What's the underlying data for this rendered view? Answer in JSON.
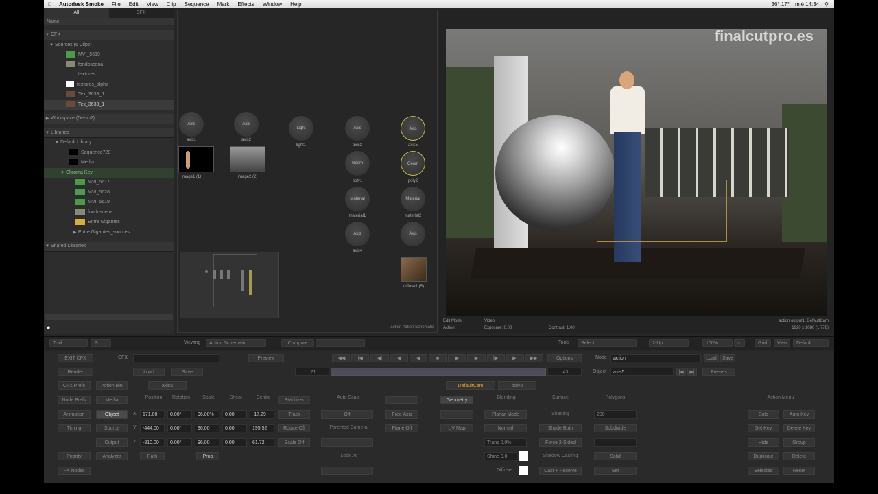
{
  "menubar": {
    "apple": "",
    "app": "Autodesk Smoke",
    "items": [
      "File",
      "Edit",
      "View",
      "Clip",
      "Sequence",
      "Mark",
      "Effects",
      "Window",
      "Help"
    ],
    "status": "36° 17°",
    "clock": "mié 14:34"
  },
  "library": {
    "tabs": [
      "All",
      "CFX"
    ],
    "col_header": "Name",
    "cfx": "CFX",
    "sources": "Sources (6 Clips)",
    "clips": [
      "MVI_5619",
      "fondoscena",
      "textures",
      "textures_alpha",
      "Tex_3633_1",
      "Tex_3633_1"
    ],
    "workspace": "Workspace (Demo2)",
    "libraries": "Libraries",
    "default_library": "Default Library",
    "lib_items": [
      "Sequence720",
      "Media",
      "Chroma Key",
      "MVI_5617",
      "MVI_5626",
      "MVI_5619",
      "fondoscena",
      "Entre Gigantes",
      "Entre Gigantes_sources"
    ],
    "shared": "Shared Libraries"
  },
  "schematic": {
    "nodes": {
      "axis1": "Axis",
      "axis2": "Axis",
      "light": "Light",
      "axis3": "Axis",
      "geom": "Geom",
      "material": "Material",
      "axis4": "Axis",
      "axis5": "Axis",
      "geom2": "Geom",
      "material2": "Material",
      "axis6": "Axis"
    },
    "labels": {
      "image1": "image1 (1)",
      "image2": "image2 (2)",
      "light1": "light1",
      "axis3": "axis3",
      "poly1": "poly1",
      "mat1": "material1",
      "axis4": "axis4",
      "axis5": "axis5",
      "poly2": "poly2",
      "mat2": "material2",
      "diffuse": "diffuse1 (5)",
      "ax1": "axis1",
      "ax2": "axis2"
    },
    "footer": "action Action Schematic"
  },
  "viewer": {
    "watermark": "finalcutpro.es",
    "info_left1": "Edit Mode",
    "info_left2": "Action",
    "info_mid1": "Video",
    "info_mid2": "Exposure: 0.00",
    "info_mid3": "Contrast: 1.00",
    "info_right1": "action output1: DefaultCam",
    "info_right2": "1920 x 1080 (1.778)"
  },
  "toolbar": {
    "trail": "Trail",
    "viewing": "Viewing",
    "viewing_val": "Action Schematic",
    "compare": "Compare",
    "tools": "Tools",
    "select": "Select",
    "view_mode": "2-Up",
    "zoom": "100%",
    "grid": "Grid",
    "view": "View",
    "default": "Default"
  },
  "controls": {
    "exit": "EXIT CFX",
    "cfx": "CFX",
    "preview": "Preview",
    "render": "Render",
    "load": "Load",
    "save": "Save",
    "frame_a": "21",
    "frame_b": "43",
    "options": "Options",
    "node_lbl": "Node",
    "node_val": "action",
    "object_lbl": "Object",
    "object_val": "axis5",
    "presets": "Presets",
    "load2": "Load",
    "save2": "Save",
    "left_btns": [
      "CFX Prefs",
      "Node Prefs",
      "Animation",
      "Timing",
      "Priority",
      "FX Nodes"
    ],
    "left2": [
      "Action Bin",
      "Media",
      "Object",
      "Source",
      "Output",
      "Analyzer"
    ],
    "tab_axis": "axis5",
    "tab_cam": "DefaultCam",
    "tab_poly": "poly2",
    "heads": [
      "Position",
      "Rotation",
      "Scale",
      "Shear",
      "Centre"
    ],
    "rows": [
      [
        "171.00",
        "0.00°",
        "96.00%",
        "0.00",
        "-17.29"
      ],
      [
        "-444.00",
        "0.00°",
        "96.00",
        "0.00",
        "195.52"
      ],
      [
        "-810.00",
        "0.00°",
        "96.00",
        "0.00",
        "61.72"
      ]
    ],
    "axes": [
      "X",
      "Y",
      "Z"
    ],
    "path": "Path",
    "prop": "Prop",
    "stabilizer": "Stabilizer",
    "track": "Track",
    "rotate_off": "Rotate Off",
    "scale_off": "Scale Off",
    "auto_scale": "Auto Scale",
    "off": "Off",
    "parented_camera": "Parented Camera",
    "look_at": "Look At",
    "free_axis": "Free Axis",
    "plane_off": "Plane Off",
    "geometry": "Geometry",
    "uv_map": "UV Map",
    "blending": "Blending",
    "planar_mode": "Planar Mode",
    "normal": "Normal",
    "trans": "Trans 0.0%",
    "shine": "Shine 0.0",
    "diffuse": "Diffuse",
    "surface": "Surface",
    "shading": "Shading",
    "shade_both": "Shade Both",
    "force_2sided": "Force 2-Sided",
    "shadow_casting": "Shadow Casting",
    "cast_receive": "Cast + Receive",
    "polygons": "Polygons",
    "poly_val": "200",
    "subdivide": "Subdivide",
    "solid": "Solid",
    "set": "Set",
    "action_menu": "Action Menu",
    "am": [
      "Solo",
      "Auto Key",
      "Set Key",
      "Delete Key",
      "Hide",
      "Group",
      "Duplicate",
      "Delete",
      "Selected",
      "Reset"
    ]
  }
}
